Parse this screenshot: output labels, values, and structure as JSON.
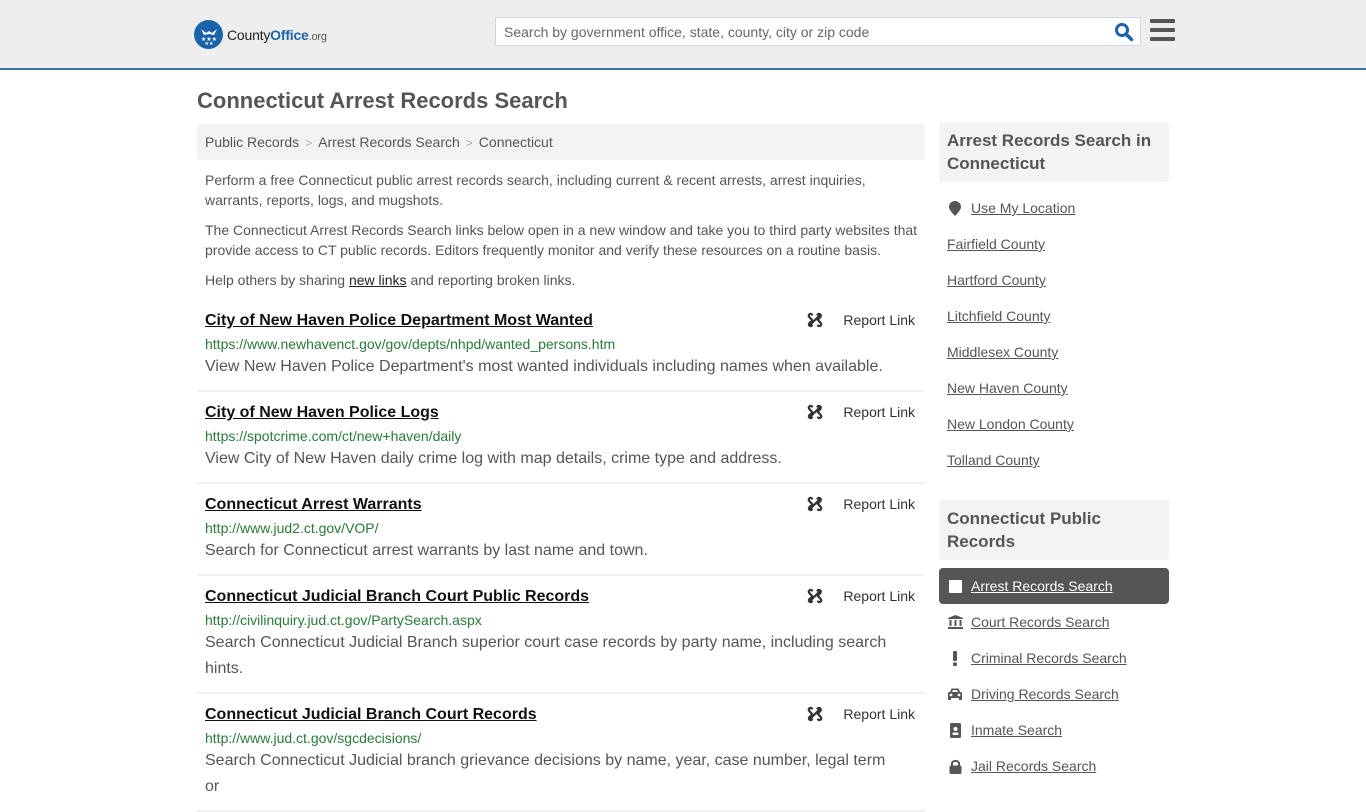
{
  "header": {
    "logo": {
      "part1": "County",
      "part2": "Office",
      "part3": ".org"
    },
    "search_placeholder": "Search by government office, state, county, city or zip code",
    "search_value": ""
  },
  "page_title": "Connecticut Arrest Records Search",
  "breadcrumb": [
    {
      "label": "Public Records"
    },
    {
      "label": "Arrest Records Search"
    },
    {
      "label": "Connecticut"
    }
  ],
  "breadcrumb_separator": ">",
  "intro": {
    "p1": "Perform a free Connecticut public arrest records search, including current & recent arrests, arrest inquiries, warrants, reports, logs, and mugshots.",
    "p2": "The Connecticut Arrest Records Search links below open in a new window and take you to third party websites that provide access to CT public records. Editors frequently monitor and verify these resources on a routine basis.",
    "p3_before": "Help others by sharing ",
    "p3_link": "new links",
    "p3_after": " and reporting broken links."
  },
  "report_label": "Report Link",
  "results": [
    {
      "title": "City of New Haven Police Department Most Wanted",
      "url": "https://www.newhavenct.gov/gov/depts/nhpd/wanted_persons.htm",
      "description": "View New Haven Police Department's most wanted individuals including names when available."
    },
    {
      "title": "City of New Haven Police Logs",
      "url": "https://spotcrime.com/ct/new+haven/daily",
      "description": "View City of New Haven daily crime log with map details, crime type and address."
    },
    {
      "title": "Connecticut Arrest Warrants",
      "url": "http://www.jud2.ct.gov/VOP/",
      "description": "Search for Connecticut arrest warrants by last name and town."
    },
    {
      "title": "Connecticut Judicial Branch Court Public Records",
      "url": "http://civilinquiry.jud.ct.gov/PartySearch.aspx",
      "description": "Search Connecticut Judicial Branch superior court case records by party name, including search hints."
    },
    {
      "title": "Connecticut Judicial Branch Court Records",
      "url": "http://www.jud.ct.gov/sgcdecisions/",
      "description": "Search Connecticut Judicial branch grievance decisions by name, year, case number, legal term or"
    }
  ],
  "sidebar": {
    "counties_heading": "Arrest Records Search in Connecticut",
    "use_location": "Use My Location",
    "counties": [
      "Fairfield County",
      "Hartford County",
      "Litchfield County",
      "Middlesex County",
      "New Haven County",
      "New London County",
      "Tolland County"
    ],
    "records_heading": "Connecticut Public Records",
    "records": [
      {
        "label": "Arrest Records Search",
        "icon": "square-icon",
        "active": true
      },
      {
        "label": "Court Records Search",
        "icon": "courthouse-icon",
        "active": false
      },
      {
        "label": "Criminal Records Search",
        "icon": "exclamation-icon",
        "active": false
      },
      {
        "label": "Driving Records Search",
        "icon": "car-icon",
        "active": false
      },
      {
        "label": "Inmate Search",
        "icon": "id-badge-icon",
        "active": false
      },
      {
        "label": "Jail Records Search",
        "icon": "lock-icon",
        "active": false
      }
    ]
  },
  "colors": {
    "brand_blue": "#1a63a8",
    "header_border": "#3d78a8",
    "url_green": "#2a7a3a",
    "active_item_bg": "#555555"
  }
}
